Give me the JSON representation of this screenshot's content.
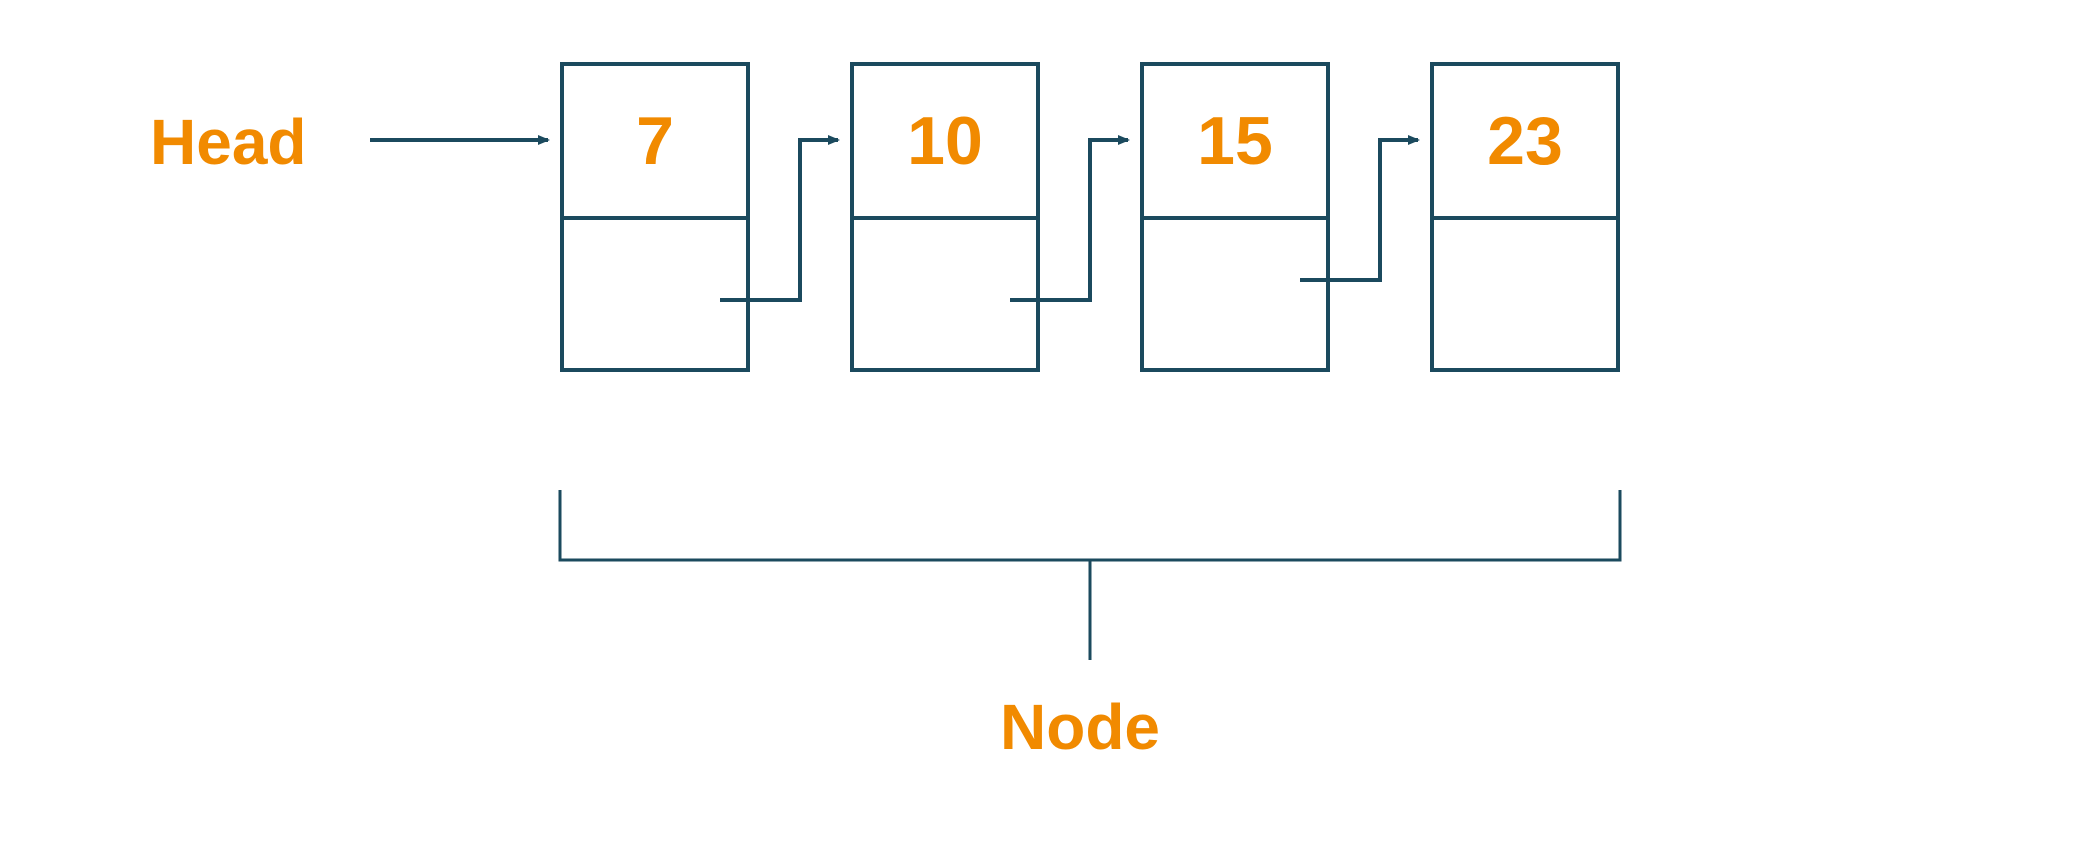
{
  "labels": {
    "head": "Head",
    "node": "Node"
  },
  "nodes": [
    {
      "value": "7"
    },
    {
      "value": "10"
    },
    {
      "value": "15"
    },
    {
      "value": "23"
    }
  ],
  "colors": {
    "accent": "#F18A00",
    "line": "#1B4A5E"
  }
}
